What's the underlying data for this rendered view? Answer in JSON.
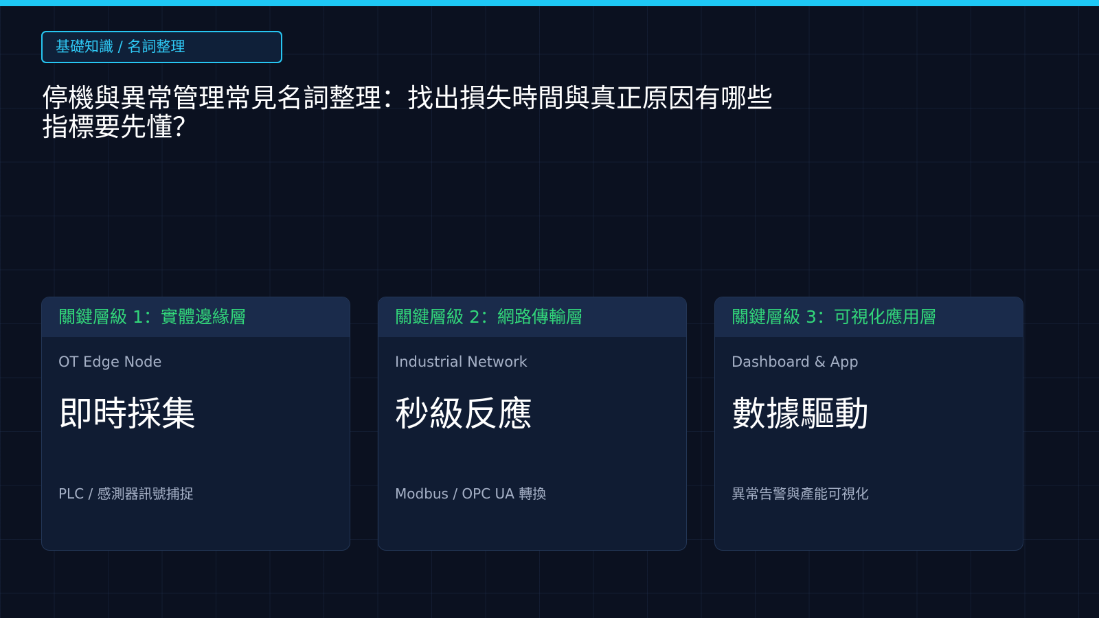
{
  "badge": {
    "label": "基礎知識 / 名詞整理"
  },
  "title": {
    "line1": "停機與異常管理常見名詞整理：找出損失時間與真正原因有哪些",
    "line2": "指標要先懂？"
  },
  "colors": {
    "accent": "#1ec8f5",
    "header_text": "#32d67a",
    "background": "#0b1120",
    "card_bg": "#101c33"
  },
  "cards": [
    {
      "header": "關鍵層級 1：實體邊緣層",
      "subtitle": "OT Edge Node",
      "headline": "即時採集",
      "description": "PLC / 感測器訊號捕捉"
    },
    {
      "header": "關鍵層級 2：網路傳輸層",
      "subtitle": "Industrial Network",
      "headline": "秒級反應",
      "description": "Modbus / OPC UA 轉換"
    },
    {
      "header": "關鍵層級 3：可視化應用層",
      "subtitle": "Dashboard & App",
      "headline": "數據驅動",
      "description": "異常告警與產能可視化"
    }
  ]
}
